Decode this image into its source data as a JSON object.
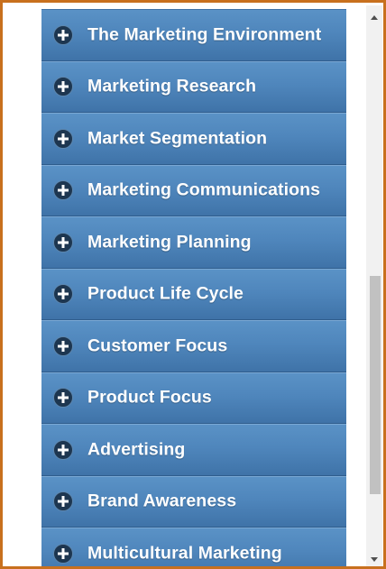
{
  "accordion": {
    "items": [
      {
        "label": "The Marketing Environment"
      },
      {
        "label": "Marketing Research"
      },
      {
        "label": "Market Segmentation"
      },
      {
        "label": "Marketing Communications"
      },
      {
        "label": "Marketing Planning"
      },
      {
        "label": "Product Life Cycle"
      },
      {
        "label": "Customer Focus"
      },
      {
        "label": "Product Focus"
      },
      {
        "label": "Advertising"
      },
      {
        "label": "Brand Awareness"
      },
      {
        "label": "Multicultural Marketing"
      }
    ],
    "expand_icon": "plus-circle-icon"
  },
  "colors": {
    "frame_border": "#c8701e",
    "item_background": "#4f86bc",
    "icon_background": "#1d3650",
    "scrollbar_thumb": "#c1c1c1"
  }
}
